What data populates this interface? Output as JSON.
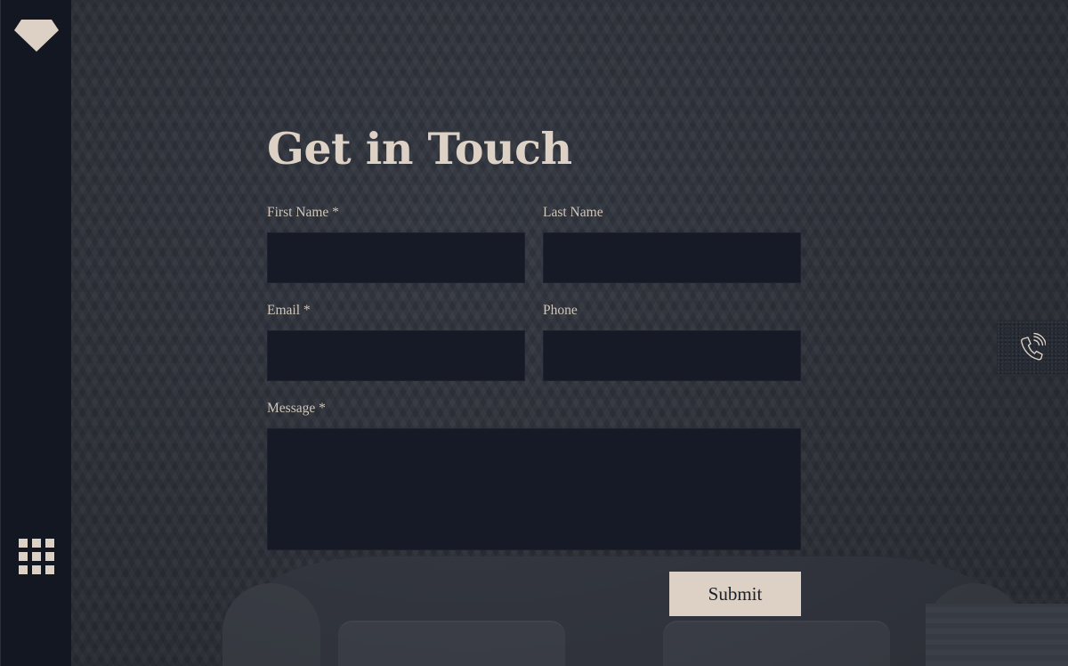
{
  "form": {
    "title": "Get in Touch",
    "first_name_label": "First Name *",
    "last_name_label": "Last Name",
    "email_label": "Email *",
    "phone_label": "Phone",
    "message_label": "Message *",
    "first_name_value": "",
    "last_name_value": "",
    "email_value": "",
    "phone_value": "",
    "message_value": "",
    "submit_label": "Submit"
  },
  "sidebar": {
    "logo_icon": "diamond-icon",
    "menu_icon": "grid-menu-icon"
  },
  "floating": {
    "contact_icon": "phone-call-icon"
  },
  "colors": {
    "accent": "#dcd1c4",
    "sidebar_bg": "#131722",
    "field_bg": "#161a26",
    "background": "#32363f"
  }
}
